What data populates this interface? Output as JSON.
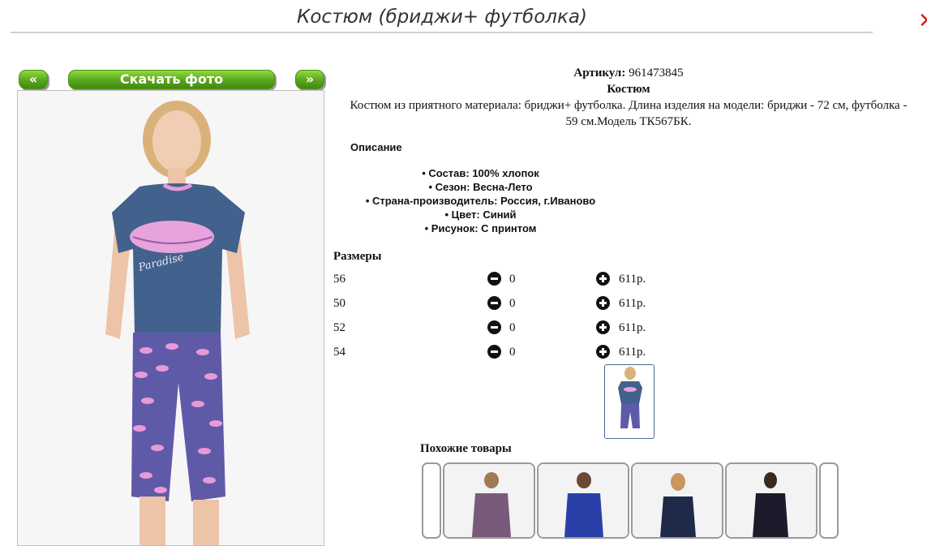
{
  "page": {
    "title": "Костюм (бриджи+ футболка)"
  },
  "gallery": {
    "prev_label": "«",
    "download_label": "Скачать фото",
    "next_label": "»"
  },
  "product": {
    "article_label": "Артикул:",
    "article_value": "961473845",
    "name": "Костюм",
    "description_line1": "Костюм из приятного материала: бриджи+ футболка. Длина изделия на модели: бриджи - 72 см, футболка -",
    "description_line2": "59 см.Модель ТК567БК.",
    "description_title": "Описание",
    "features": [
      "• Состав: 100% хлопок",
      "• Сезон: Весна-Лето",
      "• Страна-производитель: Россия, г.Иваново",
      "• Цвет: Синий",
      "• Рисунок: С принтом"
    ]
  },
  "sizes": {
    "title": "Размеры",
    "rows": [
      {
        "size": "56",
        "qty": "0",
        "price": "611р."
      },
      {
        "size": "50",
        "qty": "0",
        "price": "611р."
      },
      {
        "size": "52",
        "qty": "0",
        "price": "611р."
      },
      {
        "size": "54",
        "qty": "0",
        "price": "611р."
      }
    ]
  },
  "similar": {
    "title": "Похожие товары"
  },
  "icons": {
    "minus": "minus-circle-icon",
    "plus": "plus-circle-icon",
    "close": "close-icon"
  },
  "colors": {
    "button_green": "#5aa51e",
    "close_red": "#d61f1f"
  }
}
